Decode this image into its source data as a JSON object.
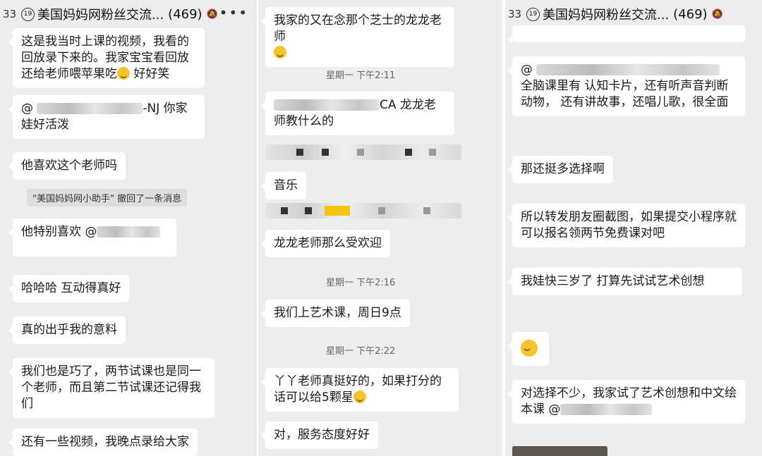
{
  "colors": {
    "panel_bg": "#ededed",
    "bubble_bg": "#ffffff",
    "separator": "#ffffff"
  },
  "chat": {
    "title": "美国妈妈网粉丝交流...",
    "member_count": "(469)",
    "unread_count": "33",
    "group_icon": "19",
    "icons": {
      "group": "group-badge-icon",
      "mute": "mute-bell-icon",
      "more": "more-dots-icon"
    }
  },
  "panel1": {
    "messages": [
      {
        "text": "这是我当时上课的视频，我看的回放录下来的。我家宝宝看回放还给老师喂苹果吃",
        "suffix": " 好好笑"
      },
      {
        "prefix": "@ ",
        "text": "-NJ 你家娃好活泼"
      },
      {
        "text": "他喜欢这个老师吗"
      },
      {
        "prefix": "他特别喜欢 @"
      },
      {
        "text": "哈哈哈 互动得真好"
      },
      {
        "text": "真的出乎我的意料"
      },
      {
        "text": "我们也是巧了，两节试课也是同一个老师，而且第二节试课还记得我们"
      },
      {
        "text": "还有一些视频，我晚点录给大家"
      }
    ],
    "system_notice": "\"美国妈妈网小助手\" 撤回了一条消息"
  },
  "panel2": {
    "messages": [
      {
        "text": "我家的又在念那个芝士的龙龙老师"
      },
      {
        "text": "CA 龙龙老师教什么的"
      },
      {
        "text": "音乐"
      },
      {
        "text": "龙龙老师那么受欢迎"
      },
      {
        "text": "我们上艺术课，周日9点"
      },
      {
        "text": "丫丫老师真挺好的，如果打分的话可以给5颗星"
      },
      {
        "text": "对，服务态度好好"
      }
    ],
    "timestamps": [
      "星期一 下午2:11",
      "星期一 下午2:16",
      "星期一 下午2:22"
    ]
  },
  "panel3": {
    "messages": [
      {
        "prefix": "@ ",
        "text": "全脑课里有 认知卡片，还有听声音判断动物， 还有讲故事，还唱儿歌，很全面"
      },
      {
        "text": "那还挺多选择啊"
      },
      {
        "text": "所以转发朋友圈截图，如果提交小程序就可以报名领两节免费课对吧"
      },
      {
        "text": "我娃快三岁了  打算先试试艺术创想"
      },
      {
        "text": "对选择不少，我家试了艺术创想和中文绘本课 @"
      }
    ]
  }
}
